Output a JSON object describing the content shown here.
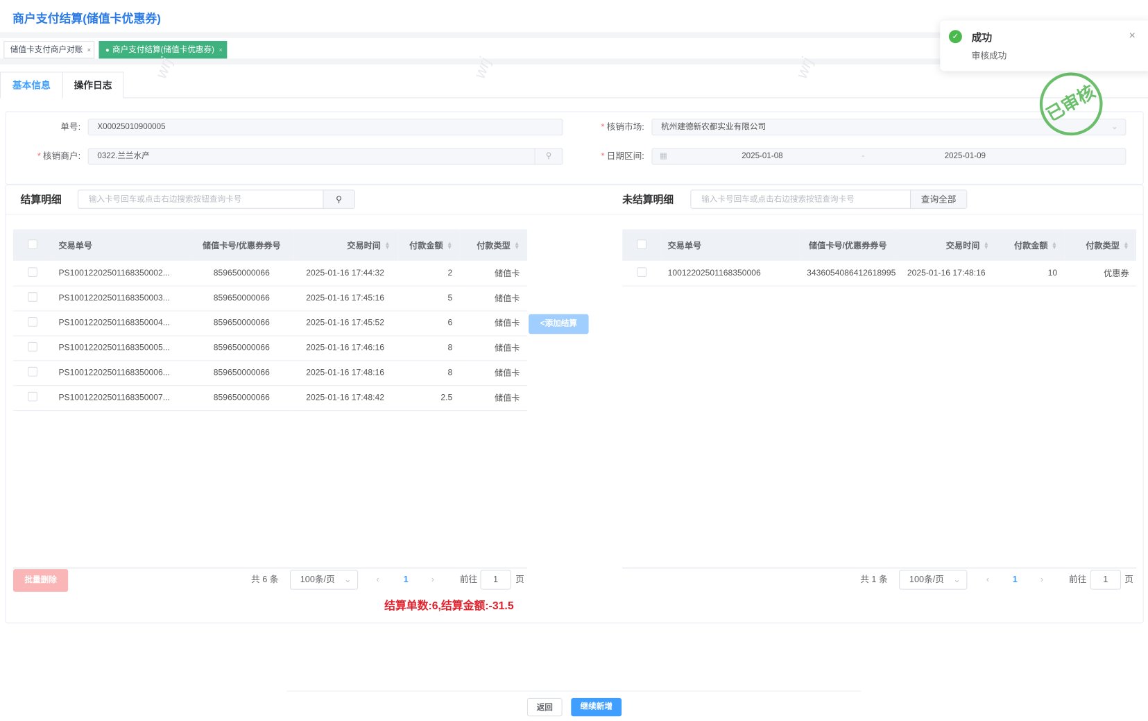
{
  "page_title": "商户支付结算(储值卡优惠券)",
  "watermark": "wrj",
  "tags": [
    {
      "label": "储值卡支付商户对账",
      "close": "×"
    },
    {
      "label": "商户支付结算(储值卡优惠券)",
      "close": "×"
    }
  ],
  "tabs": [
    {
      "label": "基本信息"
    },
    {
      "label": "操作日志"
    }
  ],
  "form": {
    "order_no_label": "单号:",
    "order_no": "X00025010900005",
    "merchant_label": "核销商户:",
    "merchant": "0322.兰兰水产",
    "market_label": "核销市场:",
    "market": "杭州建德新农都实业有限公司",
    "date_label": "日期区间:",
    "date_start": "2025-01-08",
    "date_sep": "-",
    "date_end": "2025-01-09",
    "required_mark": "*"
  },
  "stamp": "已审核",
  "toast": {
    "title": "成功",
    "message": "审核成功"
  },
  "left": {
    "title": "结算明细",
    "search_placeholder": "输入卡号回车或点击右边搜索按钮查询卡号",
    "columns": [
      "交易单号",
      "储值卡号/优惠券券号",
      "交易时间",
      "付款金额",
      "付款类型"
    ],
    "rows": [
      [
        "PS1001220250116835000​2...",
        "859650000066",
        "2025-01-16 17:44:32",
        "2",
        "储值卡"
      ],
      [
        "PS10012202501168350003...",
        "859650000066",
        "2025-01-16 17:45:16",
        "5",
        "储值卡"
      ],
      [
        "PS10012202501168350004...",
        "859650000066",
        "2025-01-16 17:45:52",
        "6",
        "储值卡"
      ],
      [
        "PS10012202501168350005...",
        "859650000066",
        "2025-01-16 17:46:16",
        "8",
        "储值卡"
      ],
      [
        "PS10012202501168350006...",
        "859650000066",
        "2025-01-16 17:48:16",
        "8",
        "储值卡"
      ],
      [
        "PS10012202501168350007...",
        "859650000066",
        "2025-01-16 17:48:42",
        "2.5",
        "储值卡"
      ]
    ],
    "batch_delete": "批量删除",
    "total": "共 6 条",
    "page_size": "100条/页",
    "page": "1",
    "goto_label": "前往",
    "goto_value": "1",
    "page_unit": "页",
    "summary": "结算单数:6,结算金额:-31.5"
  },
  "add_button": "<添加结算",
  "right": {
    "title": "未结算明细",
    "search_placeholder": "输入卡号回车或点击右边搜索按钮查询卡号",
    "query_all": "查询全部",
    "columns": [
      "交易单号",
      "储值卡号/优惠券券号",
      "交易时间",
      "付款金额",
      "付款类型"
    ],
    "rows": [
      [
        "10012202501168350006",
        "3436054086412618995",
        "2025-01-16 17:48:16",
        "10",
        "优惠券"
      ]
    ],
    "total": "共 1 条",
    "page_size": "100条/页",
    "page": "1",
    "goto_label": "前往",
    "goto_value": "1",
    "page_unit": "页"
  },
  "footer": {
    "back": "返回",
    "continue": "继续新增"
  },
  "colors": {
    "primary": "#409eff",
    "success": "#3fb27f",
    "danger": "#e0202a",
    "stamp": "#5cb85c"
  }
}
